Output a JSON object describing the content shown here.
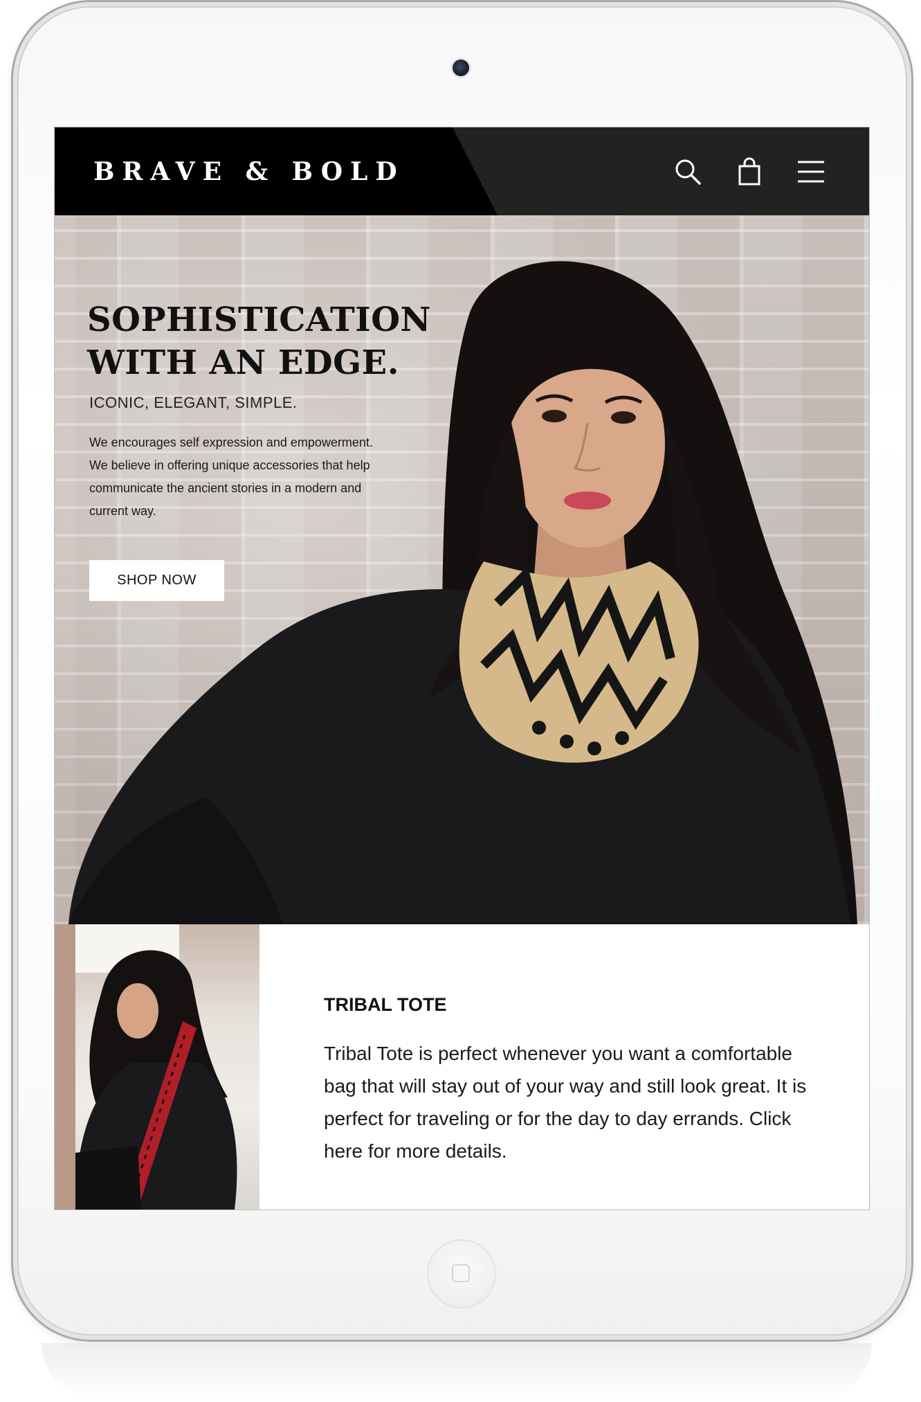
{
  "header": {
    "logo": "BRAVE & BOLD",
    "icons": [
      "search-icon",
      "shopping-bag-icon",
      "hamburger-menu-icon"
    ]
  },
  "hero": {
    "title_line1": "SOPHISTICATION",
    "title_line2": "WITH AN EDGE.",
    "subtitle": "ICONIC, ELEGANT, SIMPLE.",
    "copy": "We encourages self expression and empowerment. We believe in offering unique accessories that help communicate the ancient stories in a modern and current way.",
    "cta_label": "SHOP NOW"
  },
  "feature": {
    "title": "TRIBAL TOTE",
    "text": "Tribal Tote is perfect whenever you want a comfortable bag that will stay out of your way and still look great. It is perfect for traveling or for the day to  day  errands. Click here for more details."
  },
  "colors": {
    "header_bg": "#222222",
    "header_panel": "#000000",
    "scarf_tan": "#d6b98a",
    "tote_red": "#b01e2a"
  }
}
